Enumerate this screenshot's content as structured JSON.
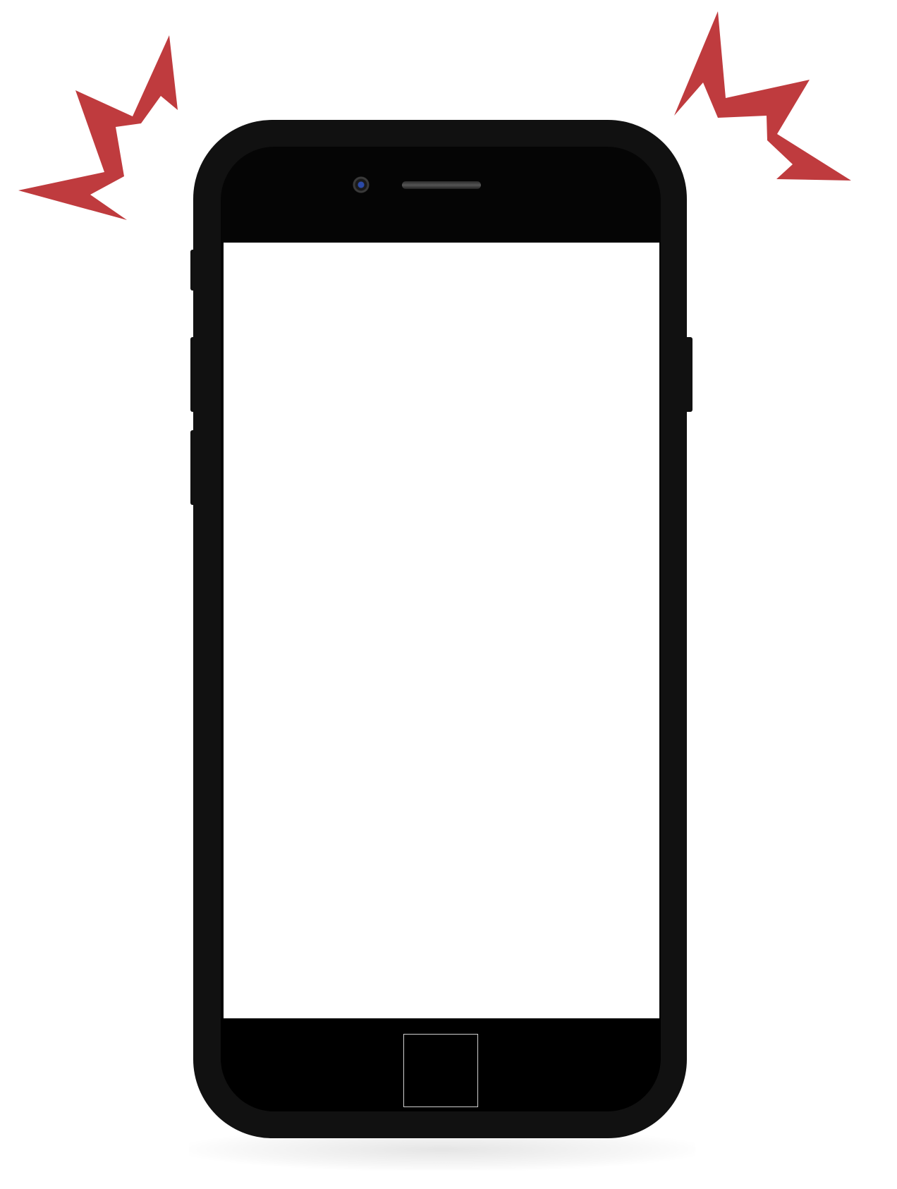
{
  "colors": {
    "burst": "#bf3b3e",
    "phone_body": "#111111",
    "bezel": "#050505",
    "screen": "#ffffff",
    "home_button_border": "#cfcfcf"
  },
  "icons": {
    "left_burst": "alert-burst-icon",
    "right_burst": "alert-burst-icon",
    "camera": "camera-icon",
    "speaker": "earpiece-speaker-icon"
  },
  "screen": {
    "content": ""
  }
}
